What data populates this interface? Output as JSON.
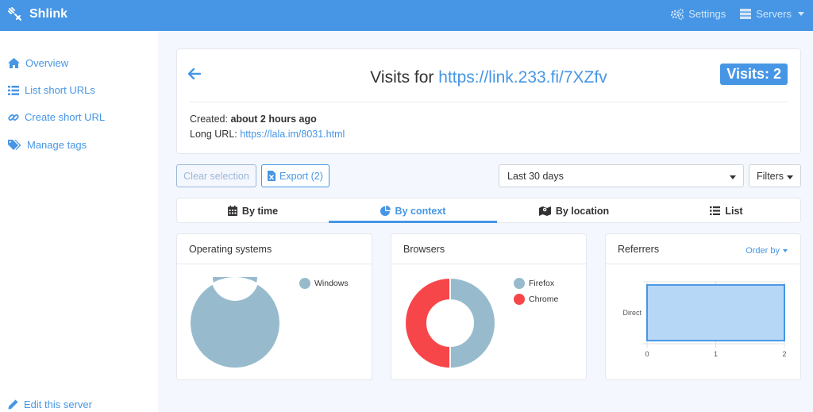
{
  "app": {
    "title": "Shlink"
  },
  "topnav": {
    "settings": "Settings",
    "servers": "Servers"
  },
  "sidebar": {
    "items": [
      {
        "label": "Overview",
        "icon": "home-icon"
      },
      {
        "label": "List short URLs",
        "icon": "list-icon"
      },
      {
        "label": "Create short URL",
        "icon": "link-icon"
      },
      {
        "label": "Manage tags",
        "icon": "tags-icon"
      }
    ],
    "footer": {
      "label": "Edit this server",
      "icon": "pencil-icon"
    }
  },
  "header": {
    "title_prefix": "Visits for",
    "short_url": "https://link.233.fi/7XZfv",
    "badge": "Visits: 2",
    "created_label": "Created:",
    "created_value": "about 2 hours ago",
    "long_url_label": "Long URL:",
    "long_url": "https://lala.im/8031.html"
  },
  "toolbar": {
    "clear_selection": "Clear selection",
    "export": "Export (2)",
    "date_range": "Last 30 days",
    "filters": "Filters"
  },
  "tabs": [
    {
      "label": "By time",
      "icon": "calendar-icon",
      "active": false
    },
    {
      "label": "By context",
      "icon": "pie-chart-icon",
      "active": true
    },
    {
      "label": "By location",
      "icon": "map-icon",
      "active": false
    },
    {
      "label": "List",
      "icon": "list-icon",
      "active": false
    }
  ],
  "colors": {
    "accent": "#4696e5",
    "windows": "#97bbcd",
    "firefox": "#97bbcd",
    "chrome": "#f7464a",
    "bar_fill": "#b6d7f5",
    "bar_border": "#4696e5"
  },
  "chart_data": [
    {
      "type": "pie",
      "title": "Operating systems",
      "categories": [
        "Windows"
      ],
      "values": [
        2
      ],
      "legend": "right"
    },
    {
      "type": "pie",
      "title": "Browsers",
      "categories": [
        "Firefox",
        "Chrome"
      ],
      "values": [
        1,
        1
      ],
      "legend": "right"
    },
    {
      "type": "bar",
      "orientation": "horizontal",
      "title": "Referrers",
      "order_by_label": "Order by",
      "categories": [
        "Direct"
      ],
      "values": [
        2
      ],
      "xlim": [
        0,
        2
      ],
      "xticks": [
        "0",
        "1",
        "2"
      ],
      "grid": true
    }
  ]
}
